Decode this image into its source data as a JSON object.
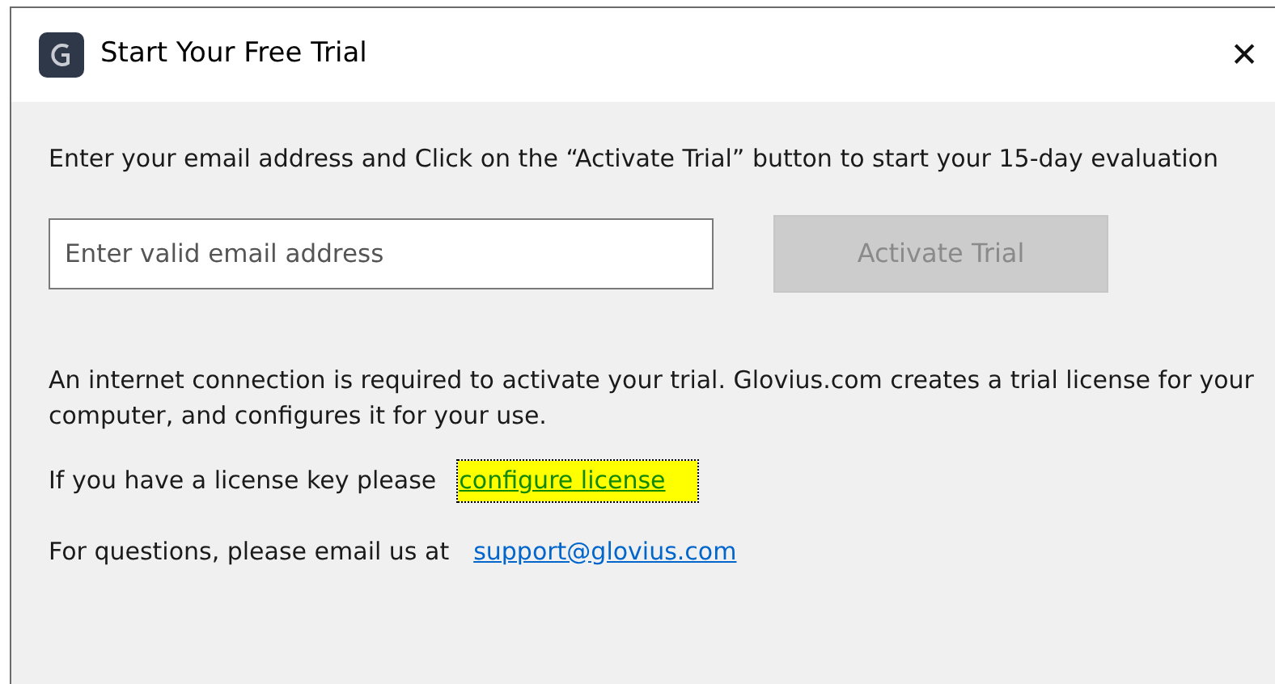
{
  "window": {
    "title": "Start Your Free Trial",
    "close": "✕"
  },
  "intro": "Enter your email address and Click on the “Activate Trial” button to start your 15-day evaluation",
  "email": {
    "placeholder": "Enter valid email address"
  },
  "activate_button": {
    "label": "Activate Trial",
    "disabled": true
  },
  "info": "An internet connection is required to activate your trial. Glovius.com creates a trial license for your computer, and configures it for your use.",
  "license_line": {
    "text": "If you have a license key please",
    "link": "configure license",
    "focused": true
  },
  "contact_line": {
    "text": "For questions, please email us at",
    "link": "support@glovius.com",
    "focused": false
  }
}
